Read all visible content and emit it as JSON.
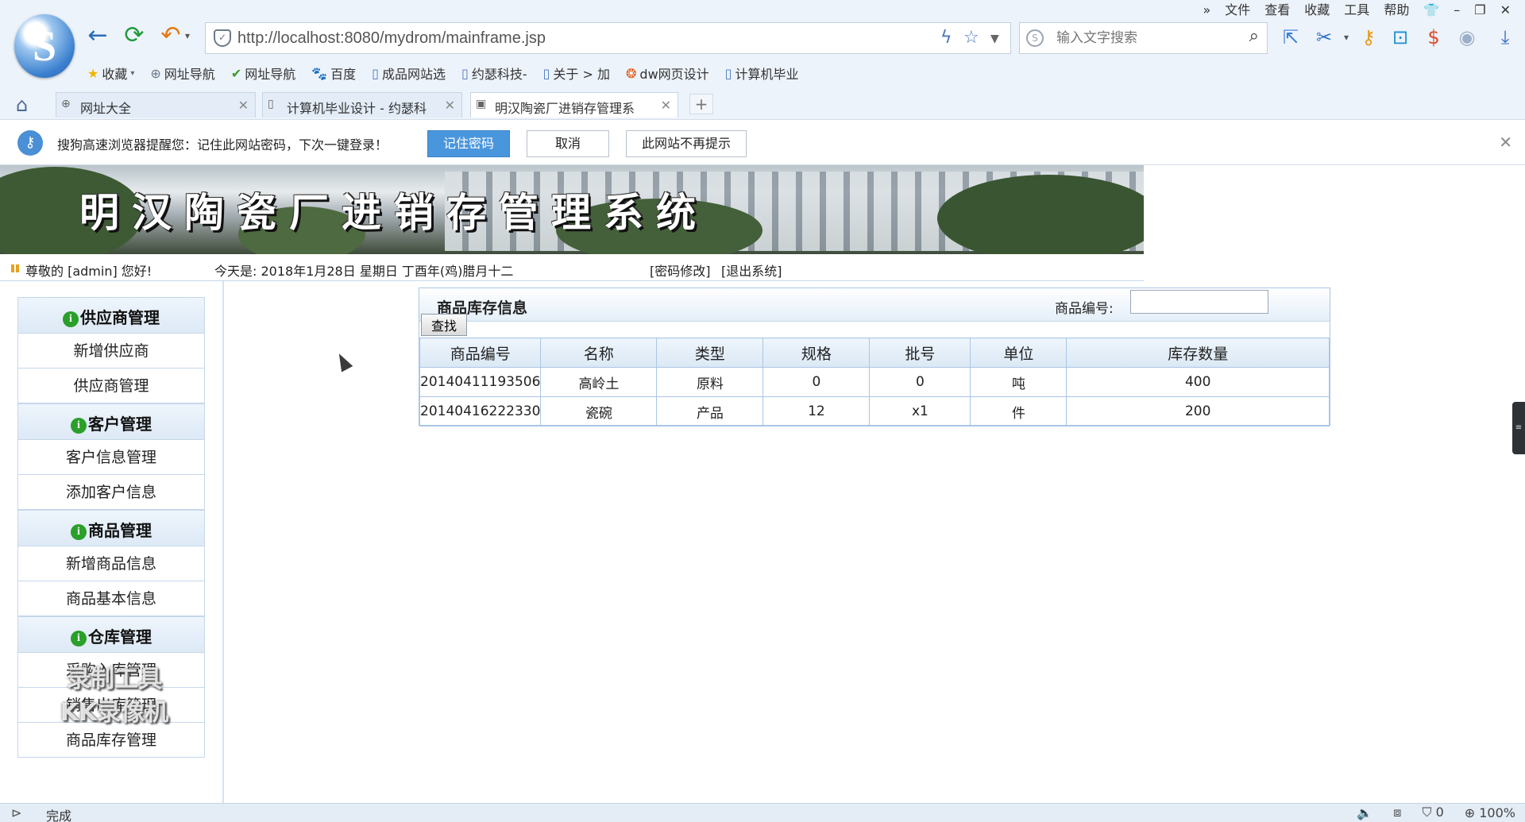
{
  "menu": [
    "»",
    "文件",
    "查看",
    "收藏",
    "工具",
    "帮助"
  ],
  "address": {
    "url": "http://localhost:8080/mydrom/mainframe.jsp"
  },
  "search": {
    "placeholder": "输入文字搜索"
  },
  "bookmarks": [
    "收藏",
    "网址导航",
    "网址导航",
    "百度",
    "成品网站选",
    "约瑟科技-",
    "关于 > 加",
    "dw网页设计",
    "计算机毕业"
  ],
  "tabs": [
    {
      "label": "网址大全"
    },
    {
      "label": "计算机毕业设计 - 约瑟科"
    },
    {
      "label": "明汉陶瓷厂进销存管理系"
    }
  ],
  "notice": {
    "text": "搜狗高速浏览器提醒您：记住此网站密码，下次一键登录！",
    "remember": "记住密码",
    "cancel": "取消",
    "never": "此网站不再提示"
  },
  "banner": {
    "title": "明汉陶瓷厂进销存管理系统"
  },
  "userbar": {
    "greeting": "尊敬的 [admin] 您好!",
    "today": "今天是:  2018年1月28日   星期日   丁酉年(鸡)腊月十二",
    "pwd": "[密码修改]",
    "logout": "[退出系统]"
  },
  "sidebar": {
    "sections": [
      {
        "title": "供应商管理",
        "items": [
          "新增供应商",
          "供应商管理"
        ]
      },
      {
        "title": "客户管理",
        "items": [
          "客户信息管理",
          "添加客户信息"
        ]
      },
      {
        "title": "商品管理",
        "items": [
          "新增商品信息",
          "商品基本信息"
        ]
      },
      {
        "title": "仓库管理",
        "items": [
          "采购入库管理",
          "销售出库管理",
          "商品库存管理"
        ]
      }
    ]
  },
  "panel": {
    "title": "商品库存信息",
    "code_label": "商品编号:",
    "code_value": "",
    "find_button": "查找",
    "columns": [
      "商品编号",
      "名称",
      "类型",
      "规格",
      "批号",
      "单位",
      "库存数量"
    ],
    "rows": [
      [
        "20140411193506",
        "高岭土",
        "原料",
        "0",
        "0",
        "吨",
        "400"
      ],
      [
        "20140416222330",
        "瓷碗",
        "产品",
        "12",
        "x1",
        "件",
        "200"
      ]
    ]
  },
  "watermark": [
    "录制工具",
    "KK录像机"
  ],
  "status": {
    "text": "完成",
    "count": "0",
    "zoom": "100%"
  }
}
